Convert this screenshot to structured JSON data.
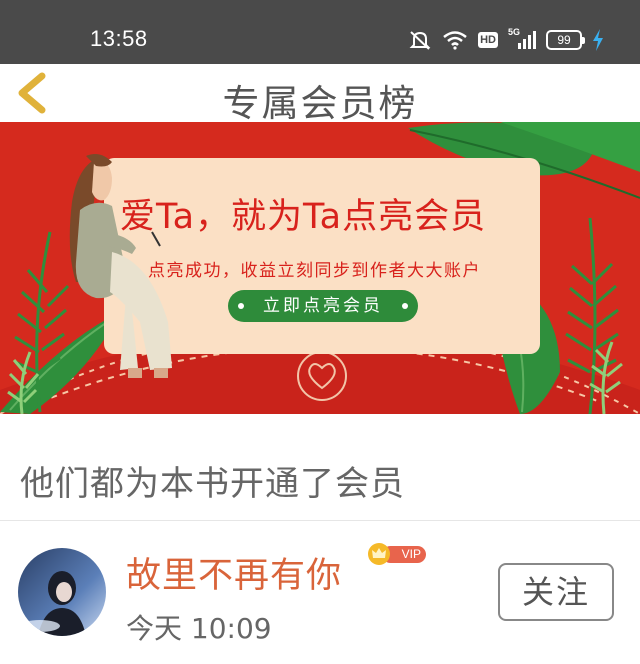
{
  "status_bar": {
    "time": "13:58",
    "network": "5G",
    "hd": "HD",
    "battery": "99",
    "icons": [
      "mute-bell-icon",
      "wifi-icon",
      "hd-icon",
      "signal-icon",
      "battery-icon",
      "charging-icon"
    ]
  },
  "header": {
    "title": "专属会员榜",
    "back_icon": "chevron-left-icon"
  },
  "banner": {
    "headline": "爱Ta，就为Ta点亮会员",
    "subtext": "点亮成功，收益立刻同步到作者大大账户",
    "cta": "立即点亮会员",
    "colors": {
      "background": "#d52a1e",
      "card": "#fbe0c5",
      "cta": "#2e8b3a",
      "leaf": "#2f8f3c"
    }
  },
  "section": {
    "title": "他们都为本书开通了会员"
  },
  "members": [
    {
      "name": "故里不再有你",
      "badge": "VIP",
      "time": "今天 10:09",
      "follow_label": "关注"
    }
  ],
  "colors": {
    "name": "#d9643a",
    "vip": "#e8644c",
    "crown": "#f5b928",
    "status_bar": "#4a4a4a"
  }
}
